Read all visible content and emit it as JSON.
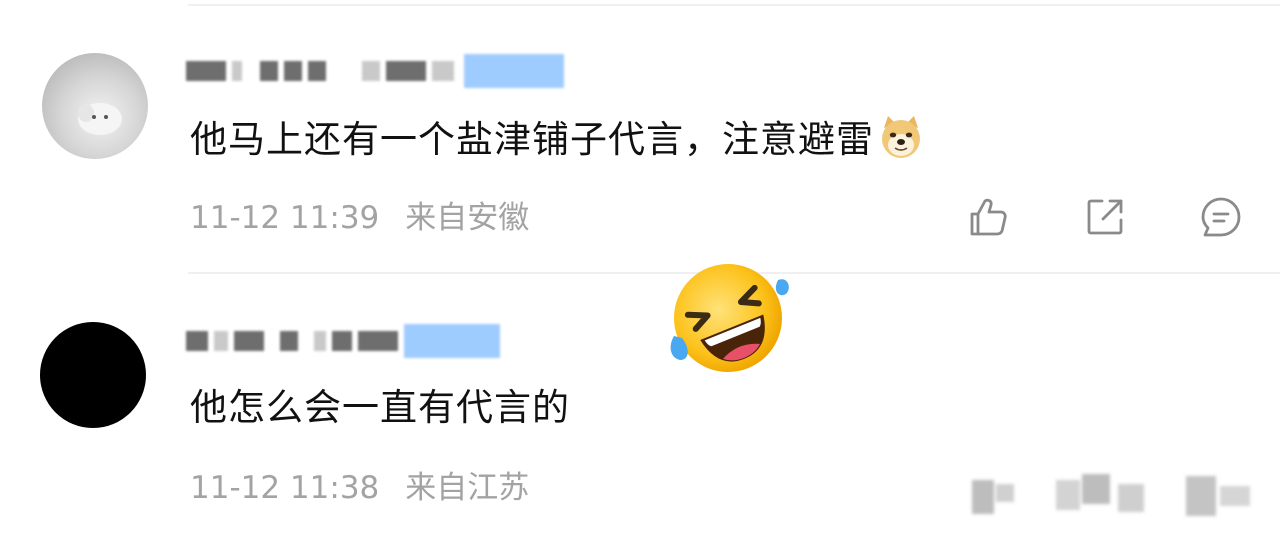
{
  "comments": [
    {
      "text": "他马上还有一个盐津铺子代言，注意避雷",
      "emoji": "doge-emoji",
      "time": "11-12 11:39",
      "location": "来自安徽",
      "actions": [
        {
          "name": "like-icon"
        },
        {
          "name": "share-icon"
        },
        {
          "name": "reply-icon"
        }
      ]
    },
    {
      "text": "他怎么会一直有代言的",
      "time": "11-12 11:38",
      "location": "来自江苏"
    }
  ],
  "overlay_emoji": "rolling-on-floor-laughing-emoji",
  "colors": {
    "text": "#111111",
    "meta": "#a3a3a3",
    "icon": "#8a8a8a",
    "divider": "#f0f0f0",
    "badge": "#8ec3ff"
  }
}
